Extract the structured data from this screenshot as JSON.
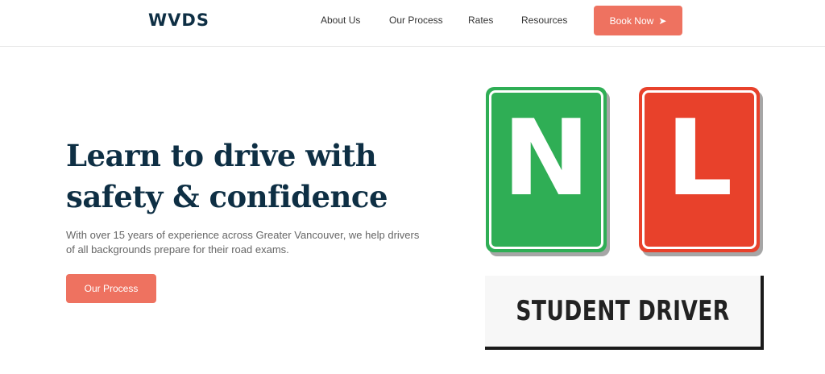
{
  "header": {
    "logo": "WVDS",
    "nav": [
      {
        "label": "About Us"
      },
      {
        "label": "Our Process"
      },
      {
        "label": "Rates"
      },
      {
        "label": "Resources"
      }
    ],
    "book_button": {
      "label": "Book Now",
      "icon": "arrow-right-icon"
    }
  },
  "hero": {
    "headline_line1": "Learn to drive with",
    "headline_line2": "safety & confidence",
    "subtext": "With over 15 years of experience across Greater Vancouver, we help drivers of all backgrounds prepare for their road exams.",
    "cta_label": "Our Process"
  },
  "graphic": {
    "plate_n": "N",
    "plate_l": "L",
    "sign_text": "STUDENT DRIVER"
  },
  "colors": {
    "accent": "#ee7260",
    "navy": "#0e2f44",
    "green": "#2fae55",
    "red": "#e8412b"
  }
}
